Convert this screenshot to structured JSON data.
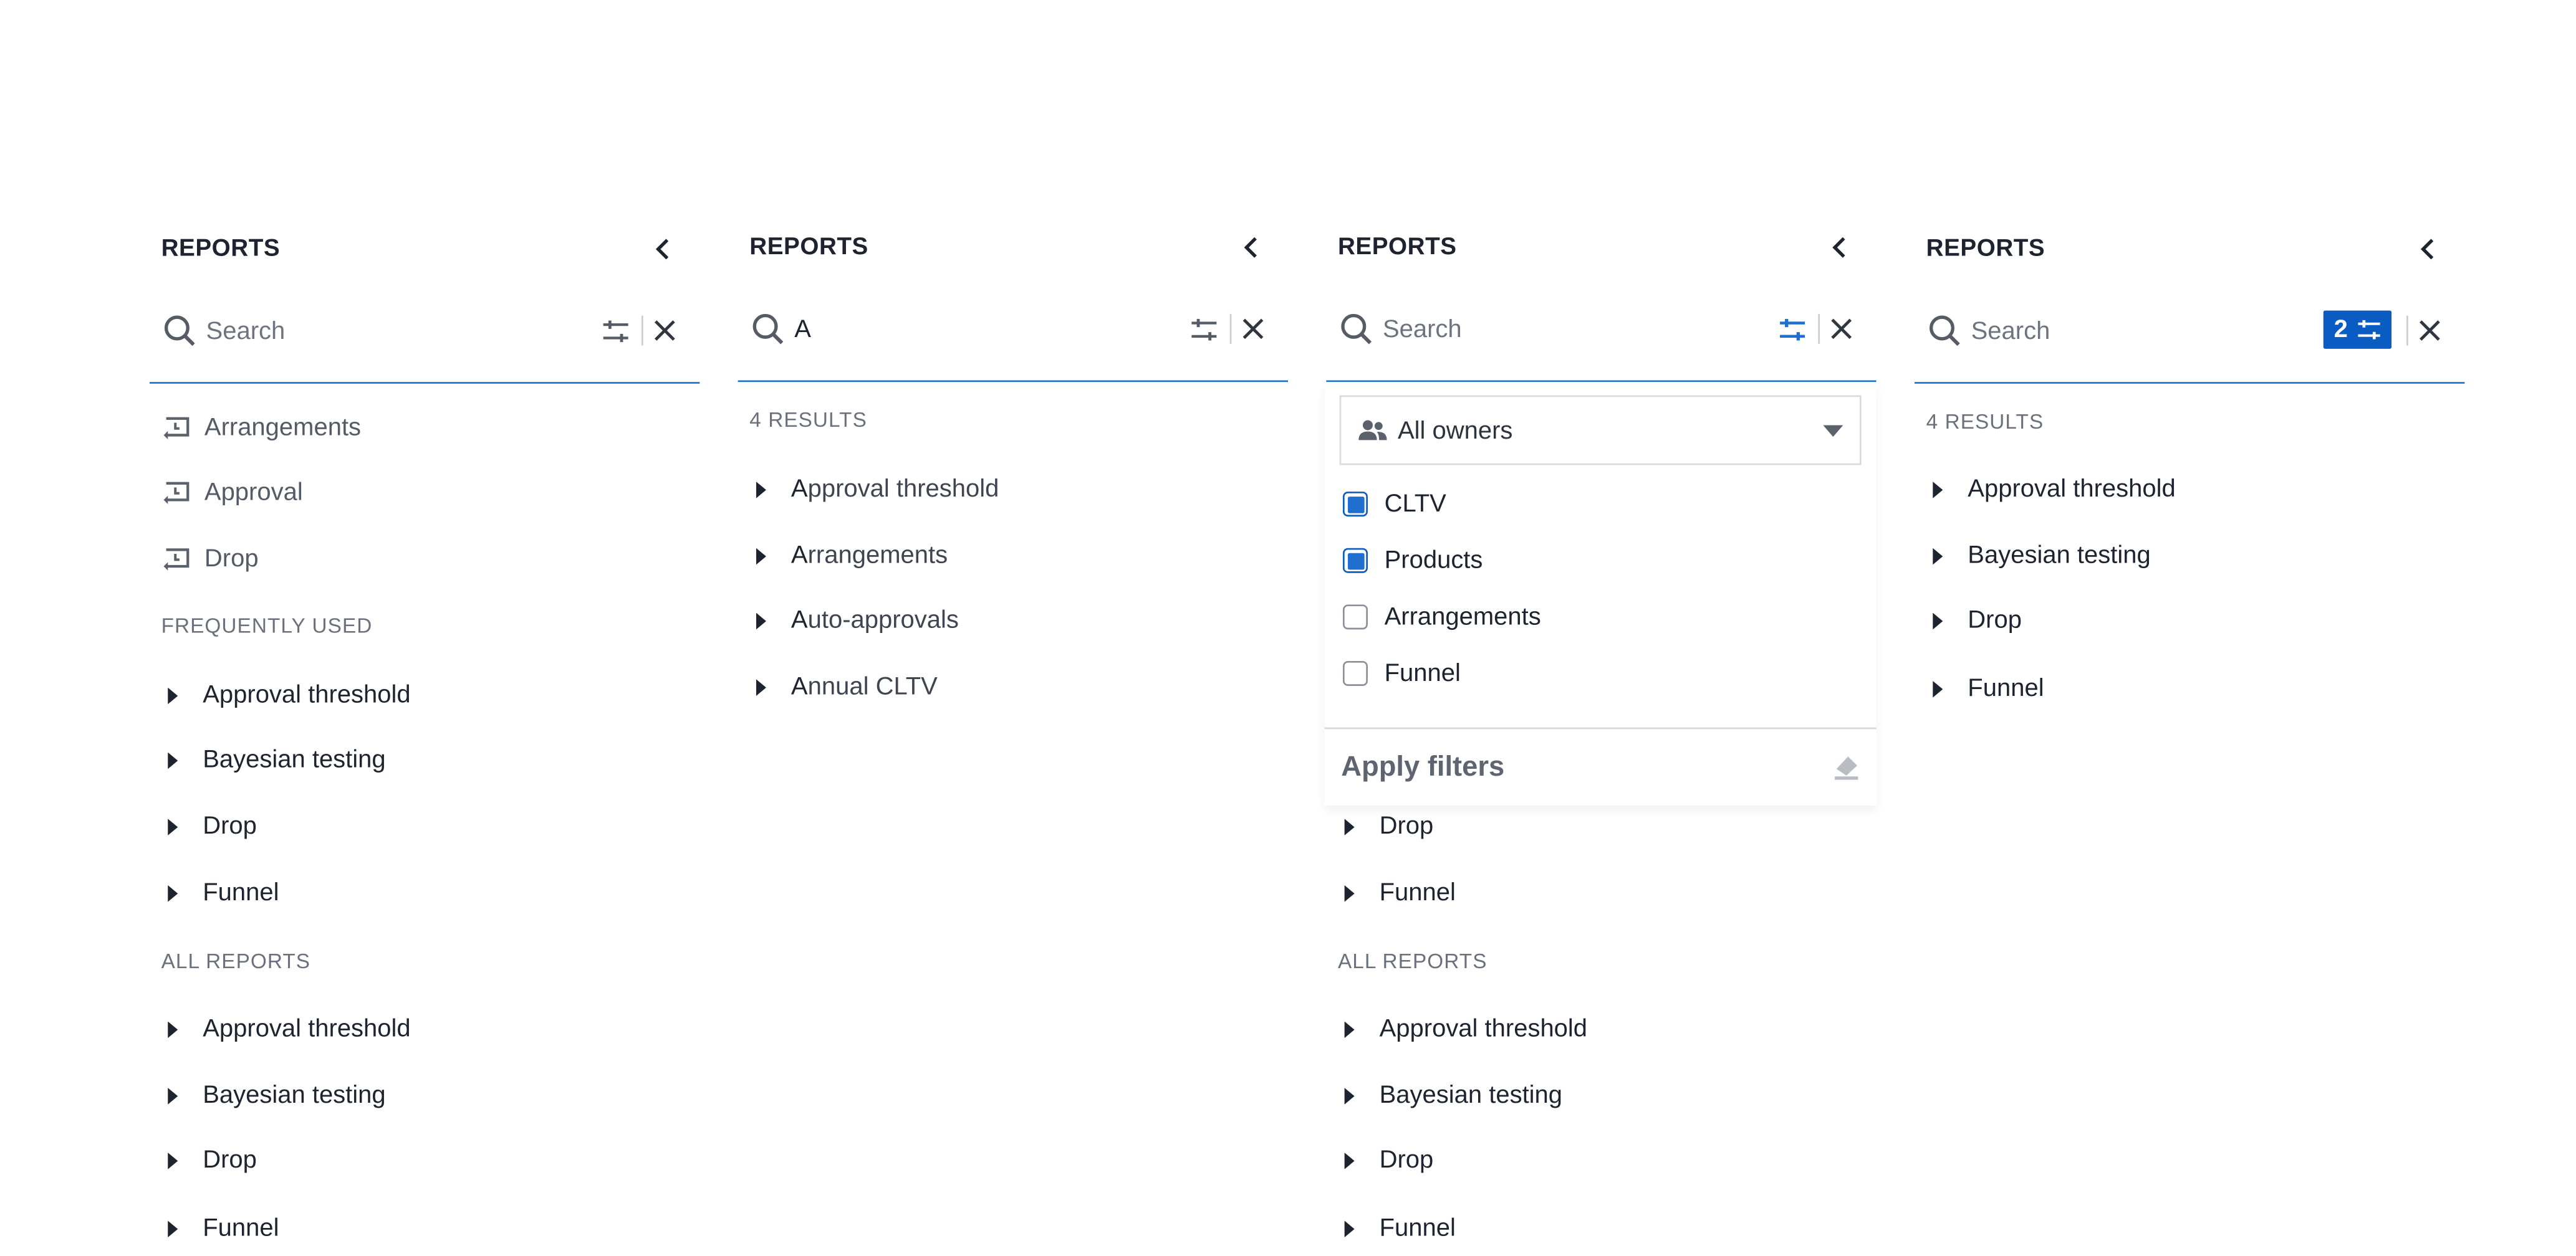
{
  "panels": [
    {
      "title": "REPORTS",
      "search": {
        "value": "",
        "placeholder": "Search"
      },
      "recent": [
        "Arrangements",
        "Approval",
        "Drop"
      ],
      "frequent": {
        "label": "FREQUENTLY USED",
        "items": [
          "Approval threshold",
          "Bayesian testing",
          "Drop",
          "Funnel"
        ]
      },
      "all": {
        "label": "ALL REPORTS",
        "items": [
          "Approval threshold",
          "Bayesian testing",
          "Drop",
          "Funnel"
        ]
      }
    },
    {
      "title": "REPORTS",
      "search": {
        "value": "A",
        "placeholder": "Search"
      },
      "results_label": "4 RESULTS",
      "results": [
        {
          "match": "A",
          "rest": "pproval threshold"
        },
        {
          "match": "A",
          "rest": "rrangements"
        },
        {
          "match": "A",
          "rest": "uto-approvals"
        },
        {
          "match": "A",
          "rest": "nnual CLTV"
        }
      ]
    },
    {
      "title": "REPORTS",
      "search": {
        "value": "",
        "placeholder": "Search"
      },
      "owners_select": "All owners",
      "filters": [
        {
          "label": "CLTV",
          "checked": true
        },
        {
          "label": "Products",
          "checked": true
        },
        {
          "label": "Arrangements",
          "checked": false
        },
        {
          "label": "Funnel",
          "checked": false
        }
      ],
      "apply_label": "Apply filters",
      "frequent_visible": [
        "Drop",
        "Funnel"
      ],
      "all": {
        "label": "ALL REPORTS",
        "items": [
          "Approval threshold",
          "Bayesian testing",
          "Drop",
          "Funnel"
        ]
      }
    },
    {
      "title": "REPORTS",
      "search": {
        "value": "",
        "placeholder": "Search"
      },
      "filter_count": "2",
      "results_label": "4 RESULTS",
      "results": [
        "Approval threshold",
        "Bayesian testing",
        "Drop",
        "Funnel"
      ]
    }
  ],
  "colors": {
    "accent": "#1f6fd0",
    "badge": "#0b5cc2",
    "text": "#1d2430",
    "muted": "#6a717c"
  }
}
